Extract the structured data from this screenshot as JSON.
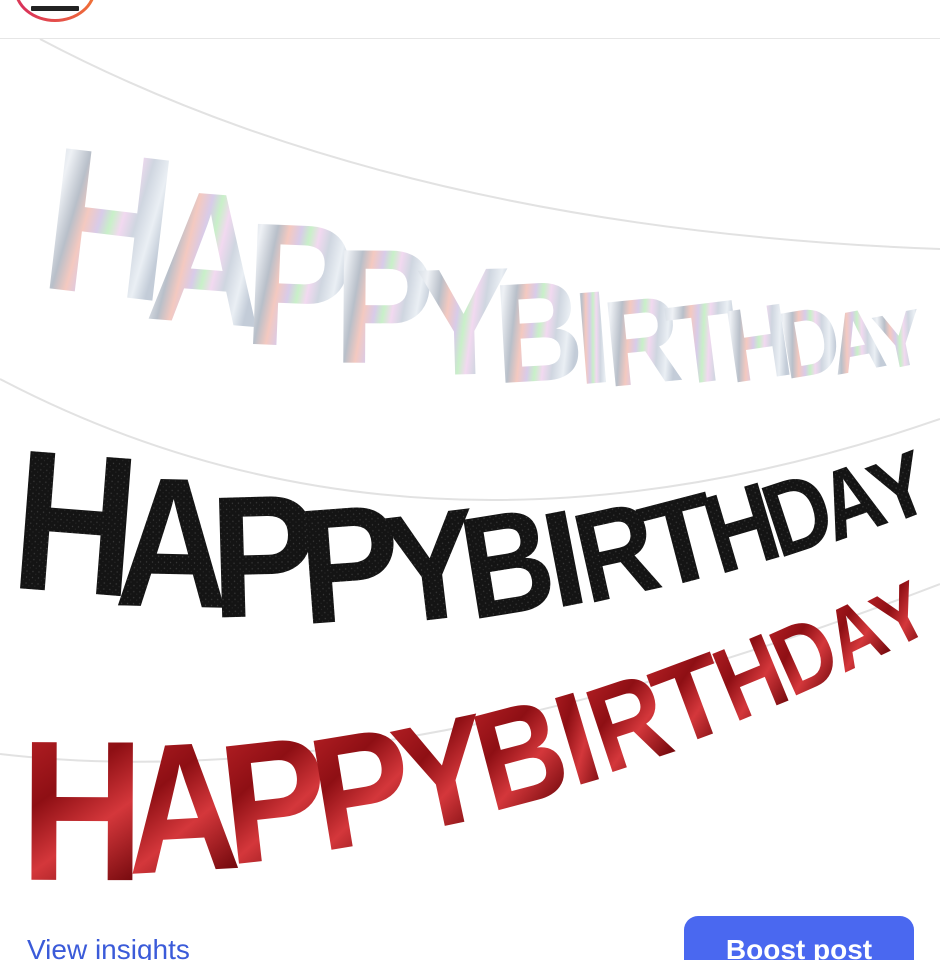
{
  "post": {
    "image_alt": "HAPPY BIRTHDAY banners in holographic silver, black glitter and red foil",
    "banners": [
      {
        "text": "HAPPYBIRTHDAY",
        "finish": "holographic-silver"
      },
      {
        "text": "HAPPYBIRTHDAY",
        "finish": "black-glitter"
      },
      {
        "text": "HAPPYBIRTHDAY",
        "finish": "red-foil"
      }
    ]
  },
  "footer": {
    "insights_label": "View insights",
    "boost_label": "Boost post"
  },
  "colors": {
    "link": "#3b5bd9",
    "boost_button": "#4a68f0",
    "black_banner": "#151515",
    "red_banner": "#a8161b"
  }
}
